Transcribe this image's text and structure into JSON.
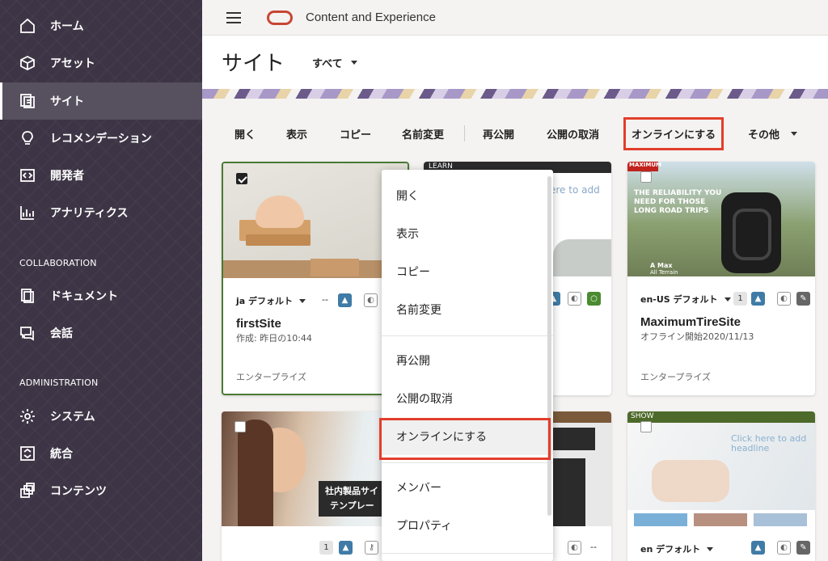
{
  "sidebar": {
    "items": [
      {
        "label": "ホーム",
        "icon": "home-icon"
      },
      {
        "label": "アセット",
        "icon": "cube-icon"
      },
      {
        "label": "サイト",
        "icon": "sites-icon"
      },
      {
        "label": "レコメンデーション",
        "icon": "lightbulb-icon"
      },
      {
        "label": "開発者",
        "icon": "code-icon"
      },
      {
        "label": "アナリティクス",
        "icon": "chart-icon"
      }
    ],
    "collaboration_label": "COLLABORATION",
    "collab_items": [
      {
        "label": "ドキュメント",
        "icon": "document-icon"
      },
      {
        "label": "会話",
        "icon": "conversation-icon"
      }
    ],
    "administration_label": "ADMINISTRATION",
    "admin_items": [
      {
        "label": "システム",
        "icon": "gear-icon"
      },
      {
        "label": "統合",
        "icon": "integration-icon"
      },
      {
        "label": "コンテンツ",
        "icon": "content-icon"
      }
    ]
  },
  "header": {
    "app_title": "Content and Experience"
  },
  "page": {
    "title": "サイト",
    "filter": "すべて"
  },
  "toolbar": {
    "open": "開く",
    "view": "表示",
    "copy": "コピー",
    "rename": "名前変更",
    "republish": "再公開",
    "unpublish": "公開の取消",
    "bring_online": "オンラインにする",
    "more": "その他"
  },
  "cards": [
    {
      "locale": "ja デフォルト",
      "dash": "--",
      "name": "firstSite",
      "sub": "作成: 昨日の10:44",
      "type": "エンタープライズ"
    },
    {
      "locale": "en-US デフォルト",
      "count": "1",
      "name": "MaximumTireSite",
      "sub": "オフライン開始2020/11/13",
      "type": "エンタープライズ",
      "thumb_brand": "MAXIMUM",
      "thumb_headline": "THE RELIABILITY YOU NEED FOR THOSE LONG ROAD TRIPS",
      "thumb_caption1": "A Max",
      "thumb_caption2": "All Terrain"
    },
    {
      "count": "1",
      "thumb_text1": "社内製品サイ",
      "thumb_text2": "テンプレー"
    },
    {
      "dash": "--"
    },
    {
      "locale": "en デフォルト",
      "thumb_brand": "SHOW",
      "thumb_headline": "Click here to add headline"
    }
  ],
  "learn_card": {
    "brand": "LEARN",
    "headline": "ere to add"
  },
  "context_menu": {
    "items": [
      "開く",
      "表示",
      "コピー",
      "名前変更",
      "再公開",
      "公開の取消",
      "オンラインにする",
      "メンバー",
      "プロパティ"
    ]
  },
  "colors": {
    "sidebar": "#3d3545",
    "accent_red": "#e23e2b",
    "oracle_red": "#c74634",
    "badge_blue": "#3f7ba6"
  }
}
